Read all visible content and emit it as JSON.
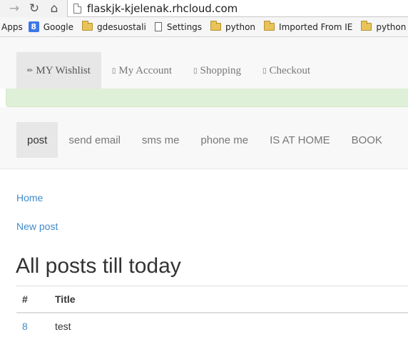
{
  "browser": {
    "url": "flaskjk-kjelenak.rhcloud.com",
    "icons": {
      "forward": "forward-arrow-icon",
      "reload": "reload-icon",
      "home": "home-icon",
      "page": "page-icon"
    },
    "bookmarks": [
      {
        "label": "Apps",
        "icon": "none"
      },
      {
        "label": "Google",
        "icon": "google-icon"
      },
      {
        "label": "gdesuostali",
        "icon": "folder-icon"
      },
      {
        "label": "Settings",
        "icon": "doc-icon"
      },
      {
        "label": "python",
        "icon": "folder-icon"
      },
      {
        "label": "Imported From IE",
        "icon": "folder-icon"
      },
      {
        "label": "python nov",
        "icon": "folder-icon"
      }
    ]
  },
  "top_nav": {
    "items": [
      {
        "label": "MY Wishlist",
        "icon": "✏"
      },
      {
        "label": "My Account",
        "icon": "▯"
      },
      {
        "label": "Shopping",
        "icon": "▯"
      },
      {
        "label": "Checkout",
        "icon": "▯"
      }
    ],
    "active_index": 0
  },
  "sub_nav": {
    "items": [
      "post",
      "send email",
      "sms me",
      "phone me",
      "IS AT HOME",
      "BOOK"
    ],
    "active_index": 0
  },
  "links": {
    "home": "Home",
    "new_post": "New post"
  },
  "page_title": "All posts till today",
  "posts_table": {
    "headers": [
      "#",
      "Title"
    ],
    "rows": [
      {
        "id": "8",
        "title": "test"
      }
    ]
  },
  "colors": {
    "link": "#428bca",
    "alert_bg": "#dff0d8",
    "nav_bg": "#f8f8f8",
    "nav_active_bg": "#e7e7e7"
  }
}
